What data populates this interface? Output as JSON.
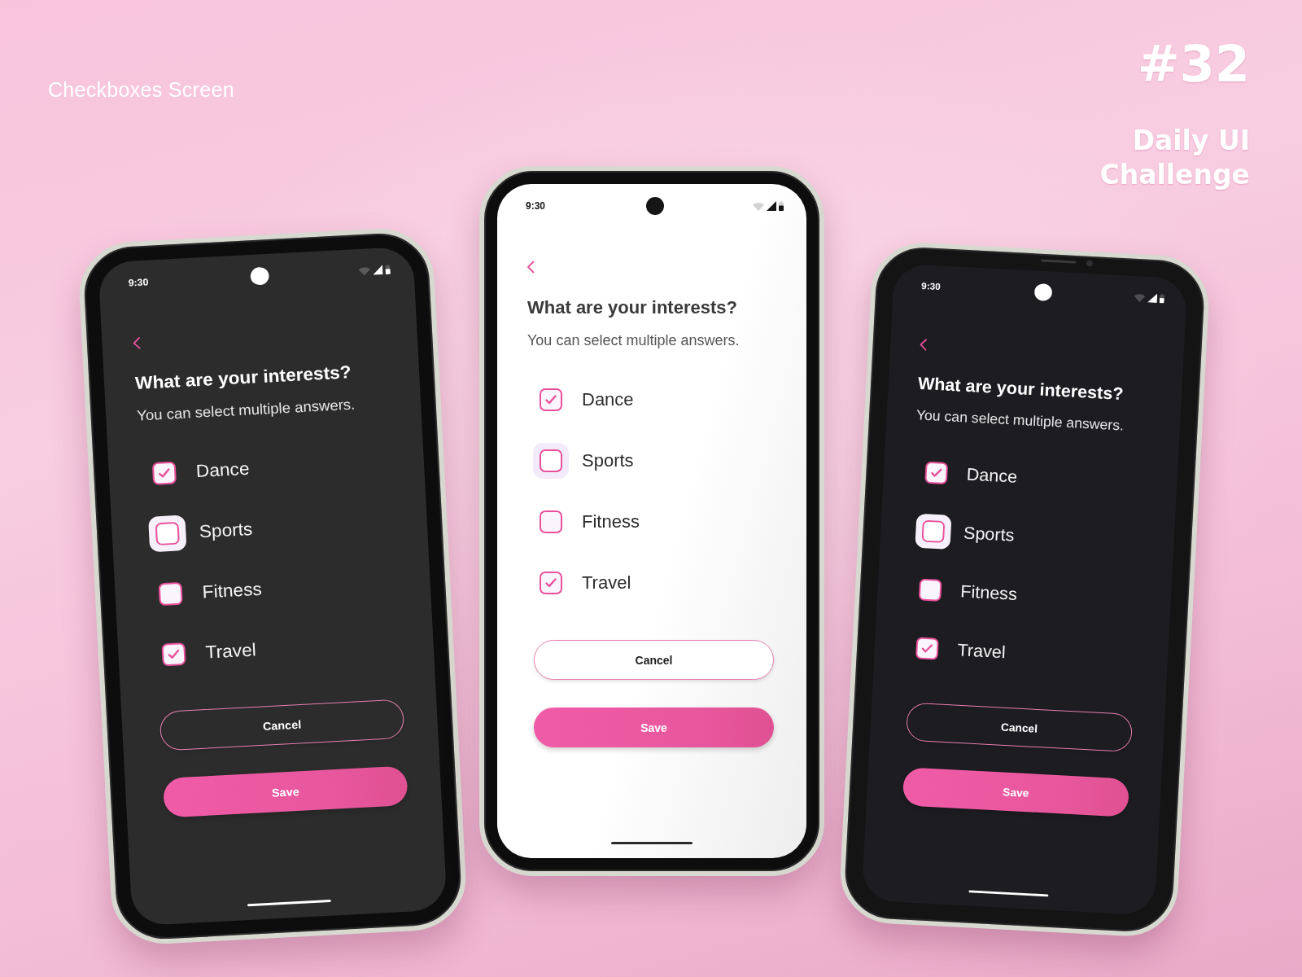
{
  "header": {
    "title": "Checkboxes Screen"
  },
  "challenge": {
    "number": "#32",
    "lines": [
      "Daily UI",
      "Challenge"
    ]
  },
  "phones": [
    {
      "kind": "dark",
      "status_bar": {
        "time": "9:30"
      },
      "title": "What are your interests?",
      "subtitle": "You can select multiple answers.",
      "options": [
        {
          "label": "Dance",
          "checked": true,
          "focused": false
        },
        {
          "label": "Sports",
          "checked": false,
          "focused": true
        },
        {
          "label": "Fitness",
          "checked": false,
          "focused": false
        },
        {
          "label": "Travel",
          "checked": true,
          "focused": false
        }
      ],
      "buttons": [
        {
          "kind": "outlined",
          "label": "Cancel"
        },
        {
          "kind": "filled",
          "label": "Save"
        }
      ]
    },
    {
      "kind": "light",
      "status_bar": {
        "time": "9:30"
      },
      "title": "What are your interests?",
      "subtitle": "You can select multiple answers.",
      "options": [
        {
          "label": "Dance",
          "checked": true,
          "focused": false
        },
        {
          "label": "Sports",
          "checked": false,
          "focused": true
        },
        {
          "label": "Fitness",
          "checked": false,
          "focused": false
        },
        {
          "label": "Travel",
          "checked": true,
          "focused": false
        }
      ],
      "buttons": [
        {
          "kind": "outlined",
          "label": "Cancel"
        },
        {
          "kind": "filled",
          "label": "Save"
        }
      ]
    },
    {
      "kind": "black",
      "status_bar": {
        "time": "9:30"
      },
      "title": "What are your interests?",
      "subtitle": "You can select multiple answers.",
      "options": [
        {
          "label": "Dance",
          "checked": true,
          "focused": false
        },
        {
          "label": "Sports",
          "checked": false,
          "focused": true
        },
        {
          "label": "Fitness",
          "checked": false,
          "focused": false
        },
        {
          "label": "Travel",
          "checked": true,
          "focused": false
        }
      ],
      "buttons": [
        {
          "kind": "outlined",
          "label": "Cancel"
        },
        {
          "kind": "filled",
          "label": "Save"
        }
      ]
    }
  ]
}
